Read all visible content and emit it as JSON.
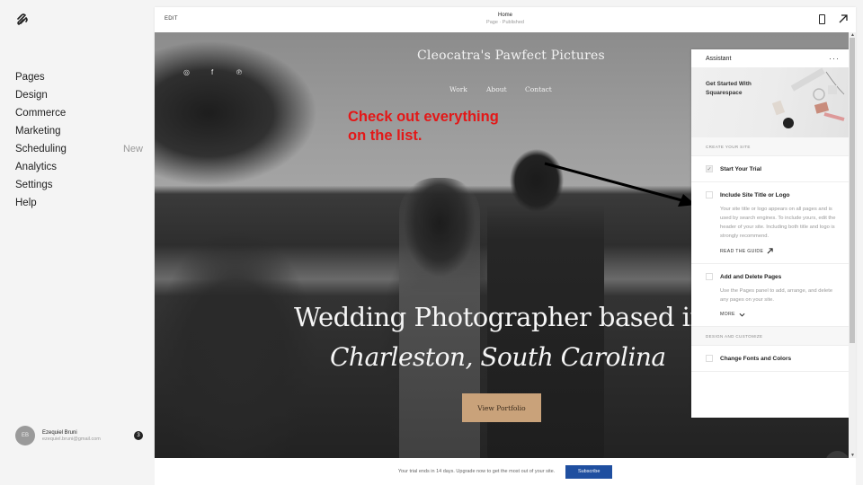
{
  "sidebar": {
    "logo_icon": "squarespace-logo-icon",
    "items": [
      {
        "label": "Pages",
        "badge": ""
      },
      {
        "label": "Design",
        "badge": ""
      },
      {
        "label": "Commerce",
        "badge": ""
      },
      {
        "label": "Marketing",
        "badge": ""
      },
      {
        "label": "Scheduling",
        "badge": "New"
      },
      {
        "label": "Analytics",
        "badge": ""
      },
      {
        "label": "Settings",
        "badge": ""
      },
      {
        "label": "Help",
        "badge": ""
      }
    ],
    "user": {
      "initials": "EB",
      "name": "Ezequiel Bruni",
      "email": "ezequiel.bruni@gmail.com",
      "notifications": "3"
    }
  },
  "topbar": {
    "edit_label": "EDIT",
    "page_title": "Home",
    "page_status": "Page · Published",
    "icons": [
      "mobile-preview-icon",
      "expand-icon"
    ]
  },
  "site": {
    "title": "Cleocatra's Pawfect Pictures",
    "social": [
      "instagram-icon",
      "facebook-icon",
      "pinterest-icon"
    ],
    "social_glyphs": [
      "◎",
      "f",
      "℗"
    ],
    "nav": [
      "Work",
      "About",
      "Contact"
    ],
    "headline_1": "Wedding Photographer based in",
    "headline_2": "Charleston, South Carolina",
    "cta": "View Portfolio"
  },
  "annotation": {
    "line_1": "Check out everything",
    "line_2": "on the list.",
    "color": "#e31818"
  },
  "assistant": {
    "title": "Assistant",
    "more": "···",
    "banner": "Get Started With Squarespace",
    "sections": [
      {
        "label": "CREATE YOUR SITE",
        "items": [
          {
            "title": "Start Your Trial",
            "checked": true
          },
          {
            "title": "Include Site Title or Logo",
            "checked": false,
            "desc": "Your site title or logo appears on all pages and is used by search engines. To include yours, edit the header of your site. Including both title and logo is strongly recommend.",
            "link": "READ THE GUIDE"
          },
          {
            "title": "Add and Delete Pages",
            "checked": false,
            "desc": "Use the Pages panel to add, arrange, and delete any pages on your site.",
            "link": "MORE"
          }
        ]
      },
      {
        "label": "DESIGN AND CUSTOMIZE",
        "items": [
          {
            "title": "Change Fonts and Colors",
            "checked": false
          }
        ]
      }
    ],
    "check_glyph": "✓",
    "close_glyph": "✕"
  },
  "trial": {
    "text": "Your trial ends in 14 days. Upgrade now to get the most out of your site.",
    "button": "Subscribe",
    "button_color": "#1f4fa0"
  }
}
